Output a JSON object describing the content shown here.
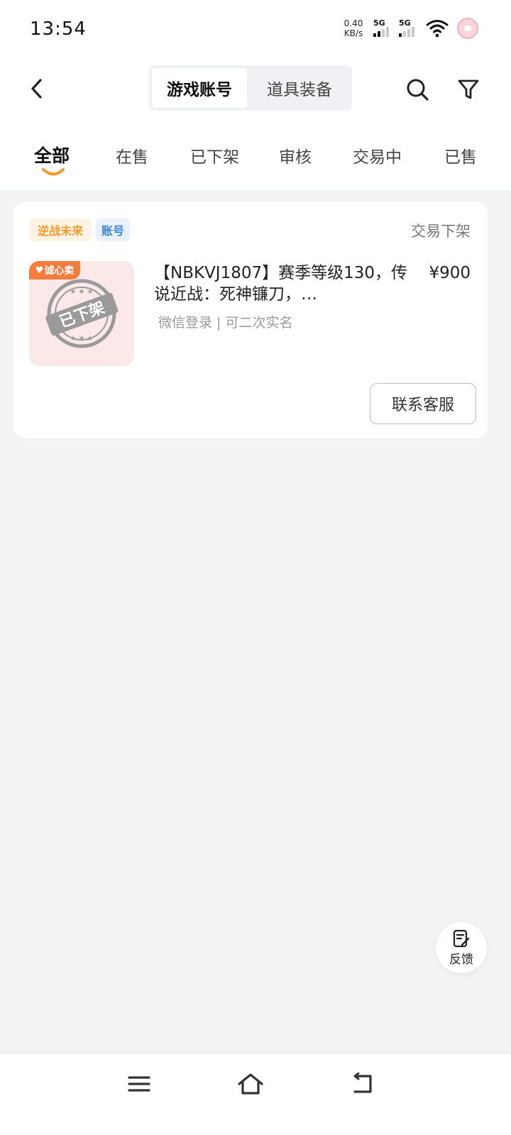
{
  "status_bar": {
    "time": "13:54",
    "net_speed_value": "0.40",
    "net_speed_unit": "KB/s",
    "sim1_label": "5G",
    "sim2_label": "5G"
  },
  "header": {
    "tabs": [
      {
        "label": "游戏账号",
        "active": true
      },
      {
        "label": "道具装备",
        "active": false
      }
    ]
  },
  "status_tabs": [
    {
      "label": "全部",
      "active": true
    },
    {
      "label": "在售",
      "active": false
    },
    {
      "label": "已下架",
      "active": false
    },
    {
      "label": "审核",
      "active": false
    },
    {
      "label": "交易中",
      "active": false
    },
    {
      "label": "已售",
      "active": false
    }
  ],
  "listing": {
    "game_tag": "逆战未来",
    "type_tag": "账号",
    "status": "交易下架",
    "badge": "诚心卖",
    "stamp_text": "已下架",
    "title": "【NBKVJ1807】赛季等级130，传说近战：死神镰刀，…",
    "price": "¥900",
    "meta": "微信登录 | 可二次实名",
    "contact_label": "联系客服"
  },
  "feedback": {
    "label": "反馈"
  },
  "colors": {
    "accent_orange": "#f59b2a",
    "tag_blue": "#3f83d8",
    "page_bg": "#f2f3f5"
  }
}
